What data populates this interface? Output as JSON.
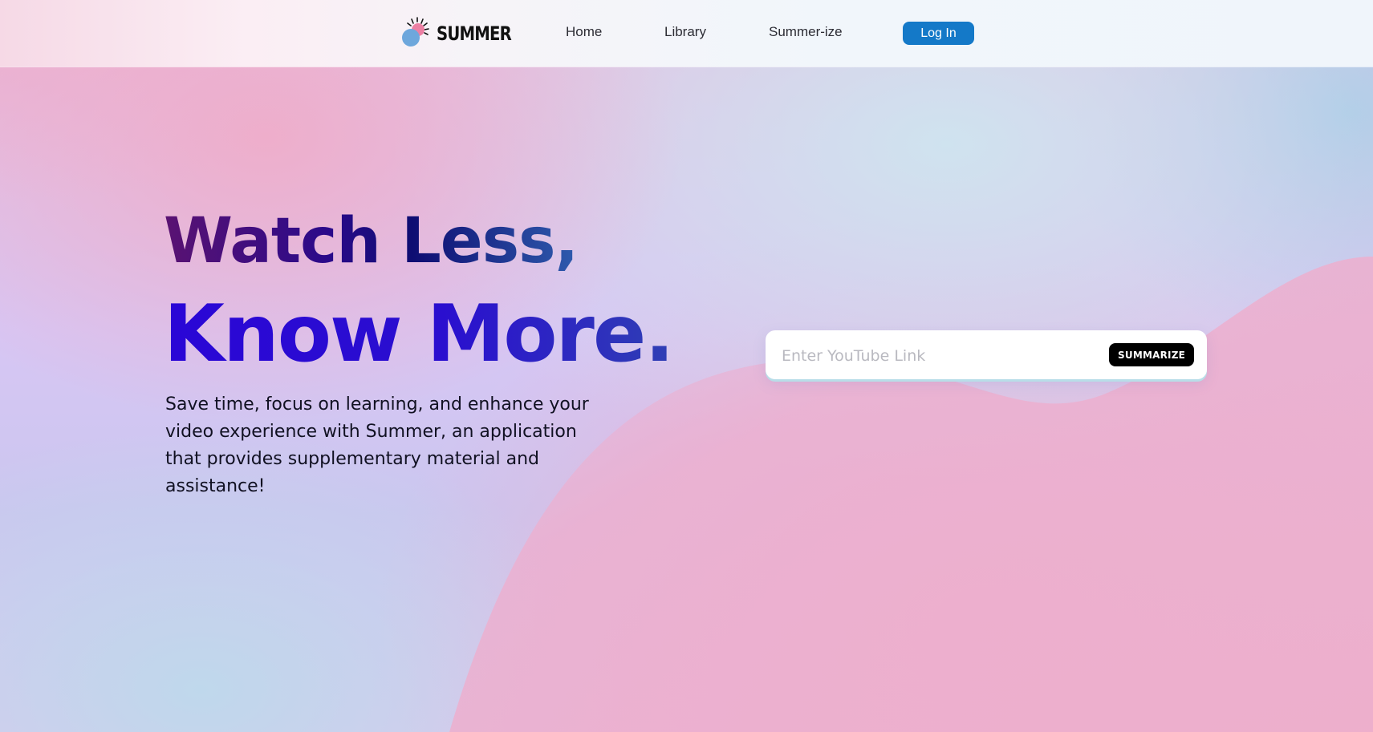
{
  "header": {
    "brand_name": "SUMMER",
    "nav": {
      "home": "Home",
      "library": "Library",
      "summerize": "Summer-ize"
    },
    "login_label": "Log In"
  },
  "hero": {
    "line1": "Watch Less,",
    "line2": "Know More.",
    "description": "Save time, focus on learning, and enhance your video experience with Summer, an application that provides supplementary material and assistance!"
  },
  "search": {
    "placeholder": "Enter YouTube Link",
    "value": "",
    "button_label": "SUMMARIZE"
  },
  "colors": {
    "login_button": "#1479c8",
    "summarize_button": "#000000",
    "headline_line2": "#2a06d6"
  },
  "icons": {
    "brand_logo": "sun-logo-icon"
  }
}
